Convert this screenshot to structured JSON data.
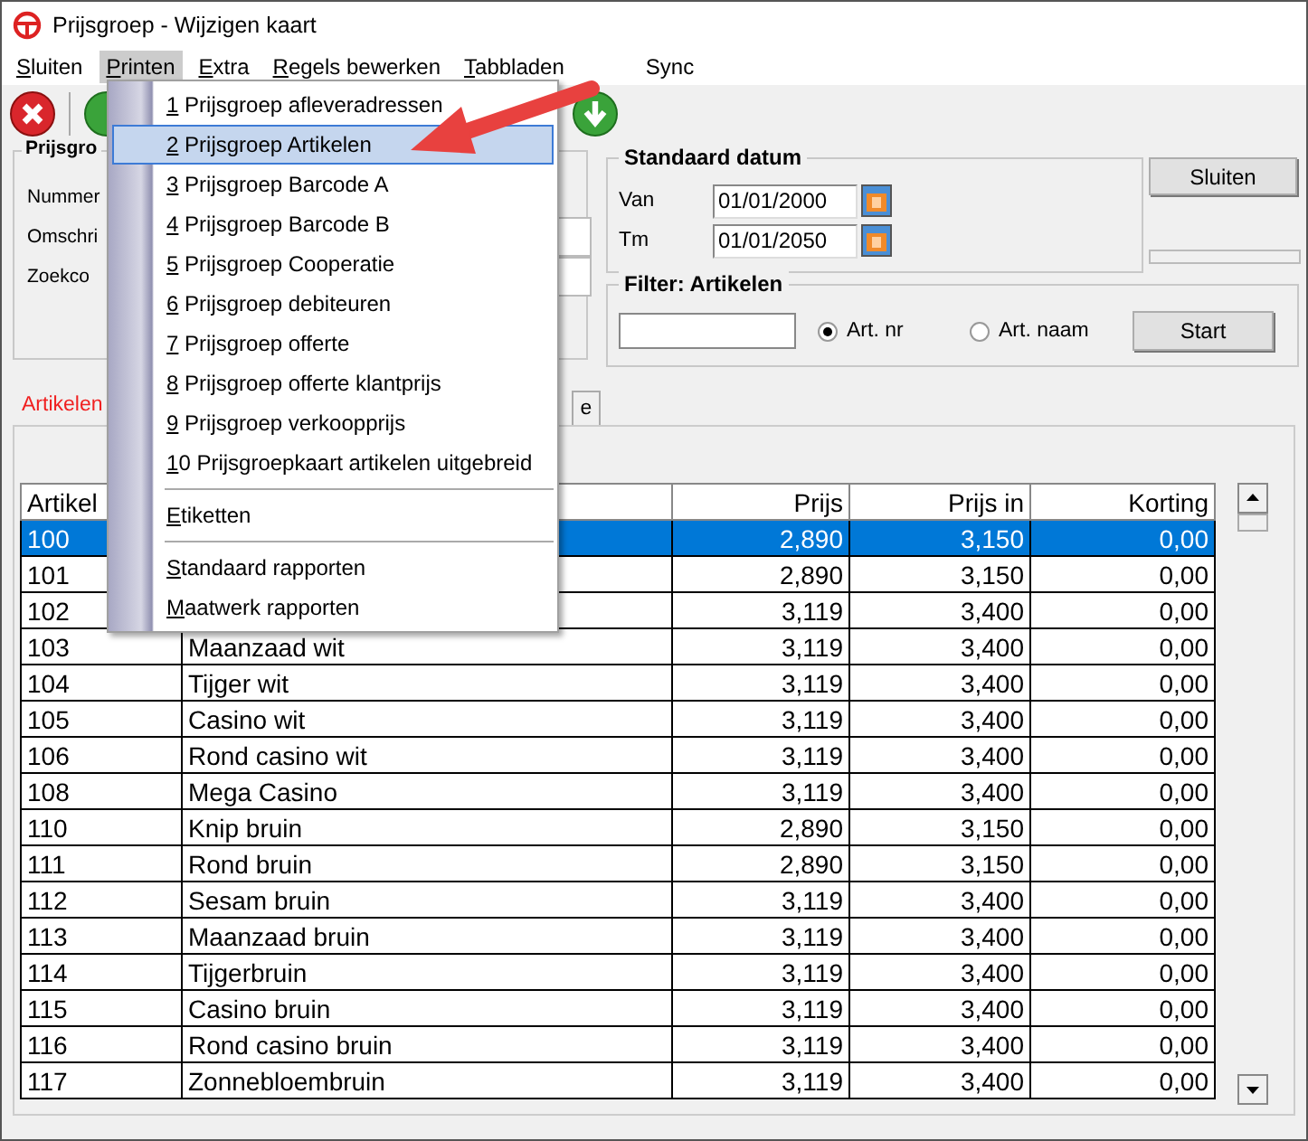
{
  "window": {
    "title": "Prijsgroep - Wijzigen kaart"
  },
  "menubar": [
    {
      "label": "Sluiten",
      "mnemonic": true,
      "selected": false
    },
    {
      "label": "Printen",
      "mnemonic": true,
      "selected": true
    },
    {
      "label": "Extra",
      "mnemonic": true,
      "selected": false
    },
    {
      "label": "Regels bewerken",
      "mnemonic": true,
      "selected": false
    },
    {
      "label": "Tabbladen",
      "mnemonic": true,
      "selected": false
    },
    {
      "label": "Sync",
      "mnemonic": false,
      "selected": false
    }
  ],
  "menu": [
    {
      "kind": "item",
      "label": "1 Prijsgroep afleveradressen",
      "selected": false
    },
    {
      "kind": "item",
      "label": "2 Prijsgroep Artikelen",
      "selected": true
    },
    {
      "kind": "item",
      "label": "3 Prijsgroep Barcode A",
      "selected": false
    },
    {
      "kind": "item",
      "label": "4 Prijsgroep Barcode B",
      "selected": false
    },
    {
      "kind": "item",
      "label": "5 Prijsgroep Cooperatie",
      "selected": false
    },
    {
      "kind": "item",
      "label": "6 Prijsgroep debiteuren",
      "selected": false
    },
    {
      "kind": "item",
      "label": "7 Prijsgroep offerte",
      "selected": false
    },
    {
      "kind": "item",
      "label": "8 Prijsgroep offerte klantprijs",
      "selected": false
    },
    {
      "kind": "item",
      "label": "9 Prijsgroep verkoopprijs",
      "selected": false
    },
    {
      "kind": "item",
      "label": "10 Prijsgroepkaart artikelen uitgebreid",
      "selected": false
    },
    {
      "kind": "separator"
    },
    {
      "kind": "item",
      "label": "Etiketten",
      "selected": false
    },
    {
      "kind": "separator"
    },
    {
      "kind": "item",
      "label": "Standaard rapporten",
      "selected": false
    },
    {
      "kind": "item",
      "label": "Maatwerk rapporten",
      "selected": false
    }
  ],
  "group_left": {
    "title": "Prijsgro",
    "labels": [
      "Nummer",
      "Omschri",
      "Zoekco"
    ]
  },
  "standaard_datum": {
    "title": "Standaard datum",
    "fields": [
      {
        "label": "Van",
        "value": "01/01/2000"
      },
      {
        "label": "Tm",
        "value": "01/01/2050"
      }
    ]
  },
  "close_button": "Sluiten",
  "filter": {
    "title": "Filter: Artikelen",
    "options": [
      {
        "label": "Art. nr",
        "selected": true
      },
      {
        "label": "Art. naam",
        "selected": false
      }
    ],
    "button": "Start"
  },
  "tabs": [
    {
      "label": "Artikelen",
      "selected": true
    },
    {
      "label": "e",
      "selected": false
    }
  ],
  "table": {
    "columns": {
      "code": "Artikel",
      "prijs": "Prijs",
      "prijs_in": "Prijs in",
      "korting": "Korting"
    },
    "rows": [
      {
        "code": "100",
        "prijs": "2,890",
        "prijs_in": "3,150",
        "korting": "0,00",
        "selected": true
      },
      {
        "code": "101",
        "prijs": "2,890",
        "prijs_in": "3,150",
        "korting": "0,00",
        "selected": false
      },
      {
        "code": "102",
        "prijs": "3,119",
        "prijs_in": "3,400",
        "korting": "0,00",
        "selected": false
      },
      {
        "code": "103",
        "description": "Maanzaad wit",
        "prijs": "3,119",
        "prijs_in": "3,400",
        "korting": "0,00",
        "selected": false
      },
      {
        "code": "104",
        "description": "Tijger wit",
        "prijs": "3,119",
        "prijs_in": "3,400",
        "korting": "0,00",
        "selected": false
      },
      {
        "code": "105",
        "description": "Casino wit",
        "prijs": "3,119",
        "prijs_in": "3,400",
        "korting": "0,00",
        "selected": false
      },
      {
        "code": "106",
        "description": "Rond casino wit",
        "prijs": "3,119",
        "prijs_in": "3,400",
        "korting": "0,00",
        "selected": false
      },
      {
        "code": "108",
        "description": "Mega Casino",
        "prijs": "3,119",
        "prijs_in": "3,400",
        "korting": "0,00",
        "selected": false
      },
      {
        "code": "110",
        "description": "Knip bruin",
        "prijs": "2,890",
        "prijs_in": "3,150",
        "korting": "0,00",
        "selected": false
      },
      {
        "code": "111",
        "description": "Rond bruin",
        "prijs": "2,890",
        "prijs_in": "3,150",
        "korting": "0,00",
        "selected": false
      },
      {
        "code": "112",
        "description": "Sesam bruin",
        "prijs": "3,119",
        "prijs_in": "3,400",
        "korting": "0,00",
        "selected": false
      },
      {
        "code": "113",
        "description": "Maanzaad bruin",
        "prijs": "3,119",
        "prijs_in": "3,400",
        "korting": "0,00",
        "selected": false
      },
      {
        "code": "114",
        "description": "Tijgerbruin",
        "prijs": "3,119",
        "prijs_in": "3,400",
        "korting": "0,00",
        "selected": false
      },
      {
        "code": "115",
        "description": "Casino bruin",
        "prijs": "3,119",
        "prijs_in": "3,400",
        "korting": "0,00",
        "selected": false
      },
      {
        "code": "116",
        "description": "Rond casino bruin",
        "prijs": "3,119",
        "prijs_in": "3,400",
        "korting": "0,00",
        "selected": false
      },
      {
        "code": "117",
        "description": "Zonnebloembruin",
        "prijs": "3,119",
        "prijs_in": "3,400",
        "korting": "0,00",
        "selected": false
      }
    ]
  }
}
